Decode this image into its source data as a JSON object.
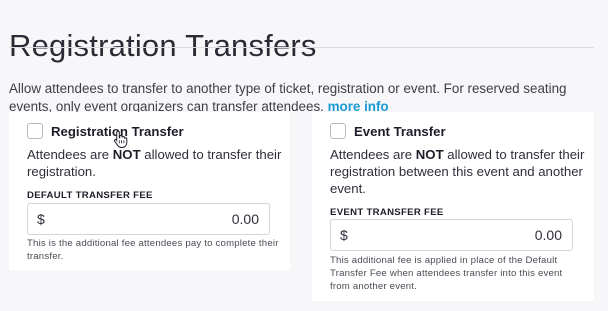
{
  "header": {
    "title": "Registration Transfers",
    "intro_text": "Allow attendees to transfer to another type of ticket, registration or event. For reserved seating events, only event organizers can transfer attendees.",
    "more_info_link": "more info"
  },
  "registration_transfer": {
    "checkbox_label": "Registration Transfer",
    "checked": false,
    "desc_prefix": "Attendees are ",
    "desc_emphasis": "NOT",
    "desc_suffix": " allowed to transfer their registration.",
    "fee_label": "DEFAULT TRANSFER FEE",
    "currency_symbol": "$",
    "fee_value": "0.00",
    "help_text": "This is the additional fee attendees pay to complete their transfer."
  },
  "event_transfer": {
    "checkbox_label": "Event Transfer",
    "checked": false,
    "desc_prefix": "Attendees are ",
    "desc_emphasis": "NOT",
    "desc_suffix": " allowed to transfer their registration between this event and another event.",
    "fee_label": "EVENT TRANSFER FEE",
    "currency_symbol": "$",
    "fee_value": "0.00",
    "help_text": "This additional fee is applied in place of the Default Transfer Fee when attendees transfer into this event from another event."
  },
  "icons": {
    "cursor": "hand-pointer-icon"
  },
  "colors": {
    "link": "#1a9bd4",
    "background": "#f7f7f9",
    "card": "#ffffff"
  }
}
